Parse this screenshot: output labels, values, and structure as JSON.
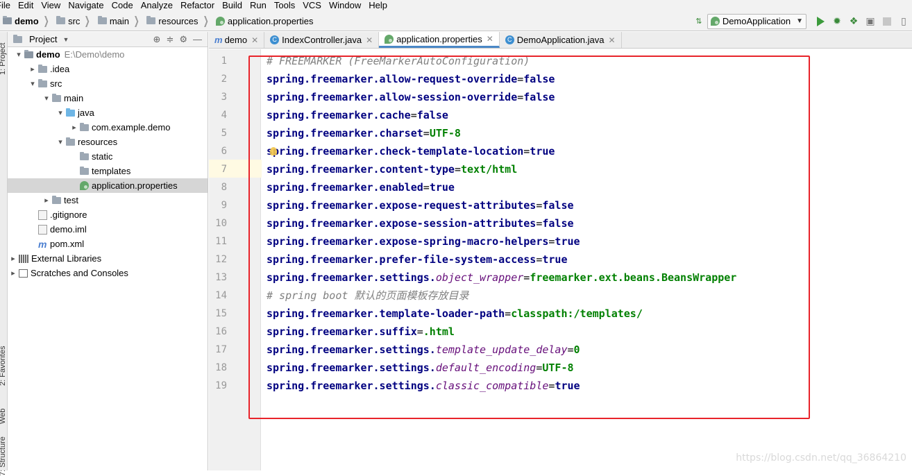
{
  "menu": [
    "File",
    "Edit",
    "View",
    "Navigate",
    "Code",
    "Analyze",
    "Refactor",
    "Build",
    "Run",
    "Tools",
    "VCS",
    "Window",
    "Help"
  ],
  "breadcrumb": [
    {
      "label": "demo",
      "icon": "project-folder-icon"
    },
    {
      "label": "src",
      "icon": "folder-icon"
    },
    {
      "label": "main",
      "icon": "folder-icon"
    },
    {
      "label": "resources",
      "icon": "resources-folder-icon"
    },
    {
      "label": "application.properties",
      "icon": "spring-leaf-icon"
    }
  ],
  "run_config": {
    "label": "DemoApplication"
  },
  "left_strip": {
    "project": "1: Project",
    "favorites": "2: Favorites",
    "web": "Web",
    "structure": "7: Structure"
  },
  "project_pane": {
    "title": "Project"
  },
  "tree": [
    {
      "label": "demo",
      "extra": "E:\\Demo\\demo",
      "arrow": "▾"
    },
    {
      "label": ".idea",
      "arrow": "▸"
    },
    {
      "label": "src",
      "arrow": "▾"
    },
    {
      "label": "main",
      "arrow": "▾"
    },
    {
      "label": "java",
      "arrow": "▾"
    },
    {
      "label": "com.example.demo",
      "arrow": "▸"
    },
    {
      "label": "resources",
      "arrow": "▾"
    },
    {
      "label": "static",
      "arrow": ""
    },
    {
      "label": "templates",
      "arrow": ""
    },
    {
      "label": "application.properties",
      "arrow": ""
    },
    {
      "label": "test",
      "arrow": "▸"
    },
    {
      "label": ".gitignore",
      "arrow": ""
    },
    {
      "label": "demo.iml",
      "arrow": ""
    },
    {
      "label": "pom.xml",
      "arrow": ""
    },
    {
      "label": "External Libraries",
      "arrow": "▸"
    },
    {
      "label": "Scratches and Consoles",
      "arrow": "▸"
    }
  ],
  "tabs": [
    {
      "label": "demo",
      "active": false
    },
    {
      "label": "IndexController.java",
      "active": false
    },
    {
      "label": "application.properties",
      "active": true
    },
    {
      "label": "DemoApplication.java",
      "active": false
    }
  ],
  "code": [
    {
      "n": "1",
      "comment": "# FREEMARKER (FreeMarkerAutoConfiguration)"
    },
    {
      "n": "2",
      "key": "spring.freemarker.allow-request-override",
      "val": "false"
    },
    {
      "n": "3",
      "key": "spring.freemarker.allow-session-override",
      "val": "false"
    },
    {
      "n": "4",
      "key": "spring.freemarker.cache",
      "val": "false"
    },
    {
      "n": "5",
      "key": "spring.freemarker.charset",
      "val": "UTF-8"
    },
    {
      "n": "6",
      "key": "spring.freemarker.check-template-location",
      "val": "true"
    },
    {
      "n": "7",
      "key": "spring.freemarker.content-type",
      "val": "text/html"
    },
    {
      "n": "8",
      "key": "spring.freemarker.enabled",
      "val": "true"
    },
    {
      "n": "9",
      "key": "spring.freemarker.expose-request-attributes",
      "val": "false"
    },
    {
      "n": "10",
      "key": "spring.freemarker.expose-session-attributes",
      "val": "false"
    },
    {
      "n": "11",
      "key": "spring.freemarker.expose-spring-macro-helpers",
      "val": "true"
    },
    {
      "n": "12",
      "key": "spring.freemarker.prefer-file-system-access",
      "val": "true"
    },
    {
      "n": "13",
      "key": "spring.freemarker.settings.",
      "ikey": "object_wrapper",
      "val": "freemarker.ext.beans.BeansWrapper"
    },
    {
      "n": "14",
      "comment": "# spring boot 默认的页面模板存放目录"
    },
    {
      "n": "15",
      "key": "spring.freemarker.template-loader-path",
      "val": "classpath:/templates/"
    },
    {
      "n": "16",
      "key": "spring.freemarker.suffix",
      "val": ".html"
    },
    {
      "n": "17",
      "key": "spring.freemarker.settings.",
      "ikey": "template_update_delay",
      "val": "0"
    },
    {
      "n": "18",
      "key": "spring.freemarker.settings.",
      "ikey": "default_encoding",
      "val": "UTF-8"
    },
    {
      "n": "19",
      "key": "spring.freemarker.settings.",
      "ikey": "classic_compatible",
      "val": "true"
    }
  ],
  "watermark": "https://blog.csdn.net/qq_36864210",
  "colors": {
    "highlight_box": "#e8232a",
    "key": "#000080",
    "value": "#008000",
    "comment": "#808080",
    "accent_tab": "#4a88c7"
  }
}
